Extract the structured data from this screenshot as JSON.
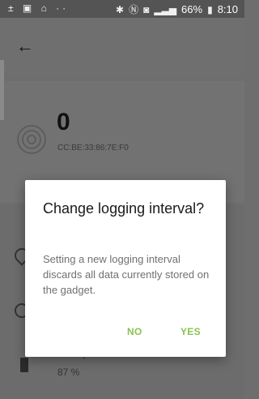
{
  "status_bar": {
    "left_icons": "± ▣ ⌂ ··",
    "battery": "66%",
    "time": "8:10"
  },
  "gadget": {
    "count": "0",
    "mac": "CC:BE:33:86:7E:F0"
  },
  "battery_row": {
    "label": "Battery Status",
    "value": "87 %"
  },
  "dialog": {
    "title": "Change logging interval?",
    "message": "Setting a new logging interval discards all data currently stored on the gadget.",
    "no_label": "NO",
    "yes_label": "YES",
    "button_color": "#8cc152"
  }
}
